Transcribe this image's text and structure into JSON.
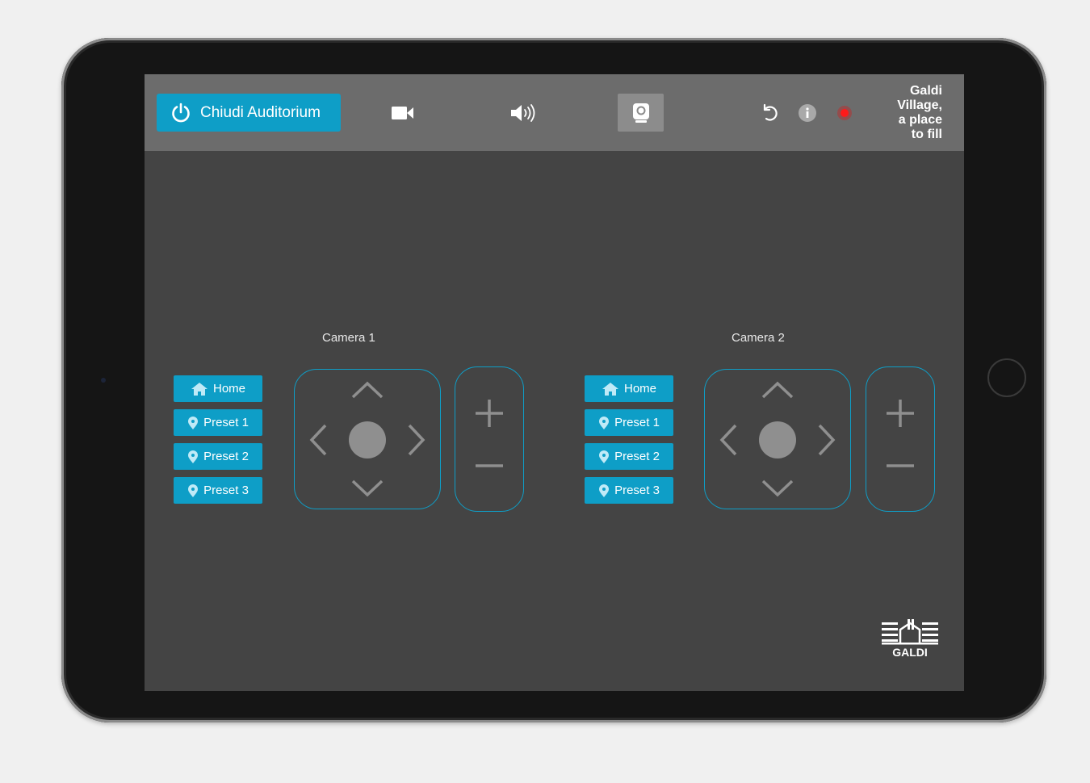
{
  "topbar": {
    "power_label": "Chiudi Auditorium",
    "icons": [
      "power-icon",
      "video-camera-icon",
      "speaker-icon",
      "webcam-icon",
      "undo-icon",
      "info-icon",
      "record-icon"
    ],
    "active_tab": "webcam",
    "brand_lines": [
      "Galdi",
      "Village,",
      "a place",
      "to fill"
    ]
  },
  "cameras": [
    {
      "label": "Camera 1",
      "presets": [
        {
          "label": "Home",
          "icon": "home-icon"
        },
        {
          "label": "Preset 1",
          "icon": "location-pin-icon"
        },
        {
          "label": "Preset 2",
          "icon": "location-pin-icon"
        },
        {
          "label": "Preset 3",
          "icon": "location-pin-icon"
        }
      ]
    },
    {
      "label": "Camera 2",
      "presets": [
        {
          "label": "Home",
          "icon": "home-icon"
        },
        {
          "label": "Preset 1",
          "icon": "location-pin-icon"
        },
        {
          "label": "Preset 2",
          "icon": "location-pin-icon"
        },
        {
          "label": "Preset 3",
          "icon": "location-pin-icon"
        }
      ]
    }
  ],
  "logo": {
    "text": "GALDI"
  },
  "colors": {
    "accent": "#0e9ec7",
    "topbar": "#6c6c6c",
    "background": "#444444",
    "record": "#e01010"
  }
}
